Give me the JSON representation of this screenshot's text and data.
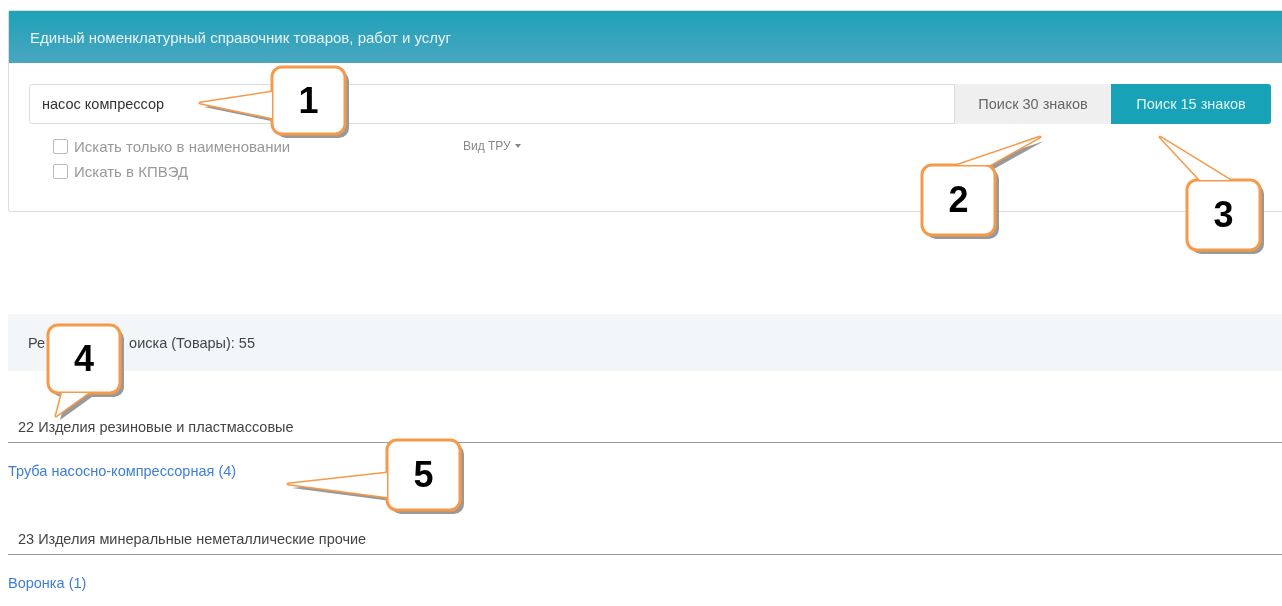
{
  "panel": {
    "title": "Единый номенклатурный справочник товаров, работ и услуг",
    "search": {
      "value": "насос компрессор"
    },
    "buttons": [
      {
        "label": "Поиск 30 знаков",
        "kind": "default"
      },
      {
        "label": "Поиск 15 знаков",
        "kind": "primary"
      }
    ],
    "options": [
      {
        "label": "Искать только в наименовании",
        "checked": false
      },
      {
        "label": "Искать в КПВЭД",
        "checked": false
      }
    ],
    "dropdown": {
      "label": "Вид ТРУ"
    }
  },
  "results": {
    "label_start": "Ре",
    "label_end": "оиска (Товары): 55"
  },
  "groups": [
    {
      "title": "22 Изделия резиновые и пластмассовые",
      "items": [
        "Труба насосно-компрессорная (4)"
      ]
    },
    {
      "title": "23 Изделия минеральные неметаллические прочие",
      "items": [
        "Воронка (1)"
      ]
    }
  ],
  "callouts": [
    "1",
    "2",
    "3",
    "4",
    "5"
  ]
}
